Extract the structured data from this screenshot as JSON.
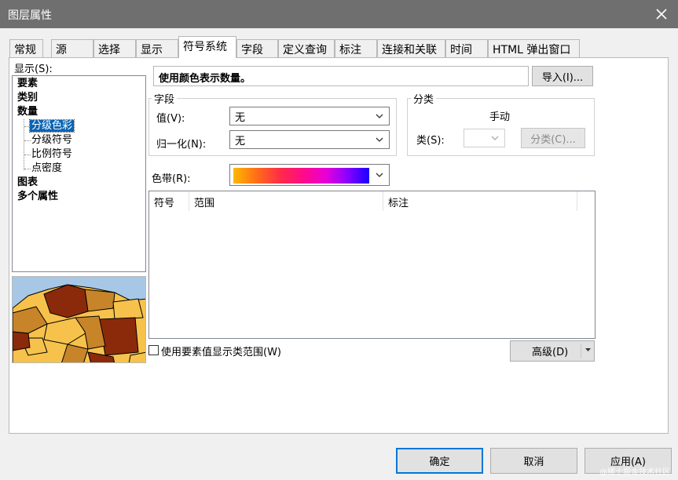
{
  "window": {
    "title": "图层属性",
    "close_glyph": "✕"
  },
  "tabs": [
    {
      "label": "常规"
    },
    {
      "label": "源"
    },
    {
      "label": "选择"
    },
    {
      "label": "显示"
    },
    {
      "label": "符号系统",
      "active": true
    },
    {
      "label": "字段"
    },
    {
      "label": "定义查询"
    },
    {
      "label": "标注"
    },
    {
      "label": "连接和关联"
    },
    {
      "label": "时间"
    },
    {
      "label": "HTML 弹出窗口"
    }
  ],
  "show_panel": {
    "label": "显示(S):",
    "items": [
      {
        "label": "要素",
        "bold": true
      },
      {
        "label": "类别",
        "bold": true
      },
      {
        "label": "数量",
        "bold": true
      },
      {
        "label": "分级色彩",
        "selected": true
      },
      {
        "label": "分级符号"
      },
      {
        "label": "比例符号"
      },
      {
        "label": "点密度"
      },
      {
        "label": "图表",
        "bold": true
      },
      {
        "label": "多个属性",
        "bold": true
      }
    ]
  },
  "description": "使用颜色表示数量。",
  "import_button": "导入(I)...",
  "field_group": {
    "title": "字段",
    "value_label": "值(V):",
    "value": "无",
    "normalize_label": "归一化(N):",
    "normalize": "无"
  },
  "classification": {
    "title": "分类",
    "method": "手动",
    "classes_label": "类(S):",
    "classes_value": "",
    "classify_button": "分类(C)..."
  },
  "color_ramp": {
    "label": "色带(R):"
  },
  "symbol_table": {
    "columns": [
      "符号",
      "范围",
      "标注"
    ]
  },
  "checkbox": {
    "label": "使用要素值显示类范围(W)",
    "checked": false
  },
  "advanced_button": "高级(D)",
  "footer": {
    "ok": "确定",
    "cancel": "取消",
    "apply": "应用(A)"
  },
  "watermark": "@稀土掘金技术社区",
  "colors": {
    "selected_item": "#0a64b4",
    "default_button_border": "#0078d7",
    "titlebar": "#6f6f6f",
    "map_water": "#a6c8e6",
    "map_dark": "#8b2a0a",
    "map_mid": "#c88428",
    "map_light": "#f6c24c"
  },
  "icons": {
    "close": "close-icon",
    "dropdown": "chevron-down-icon"
  }
}
